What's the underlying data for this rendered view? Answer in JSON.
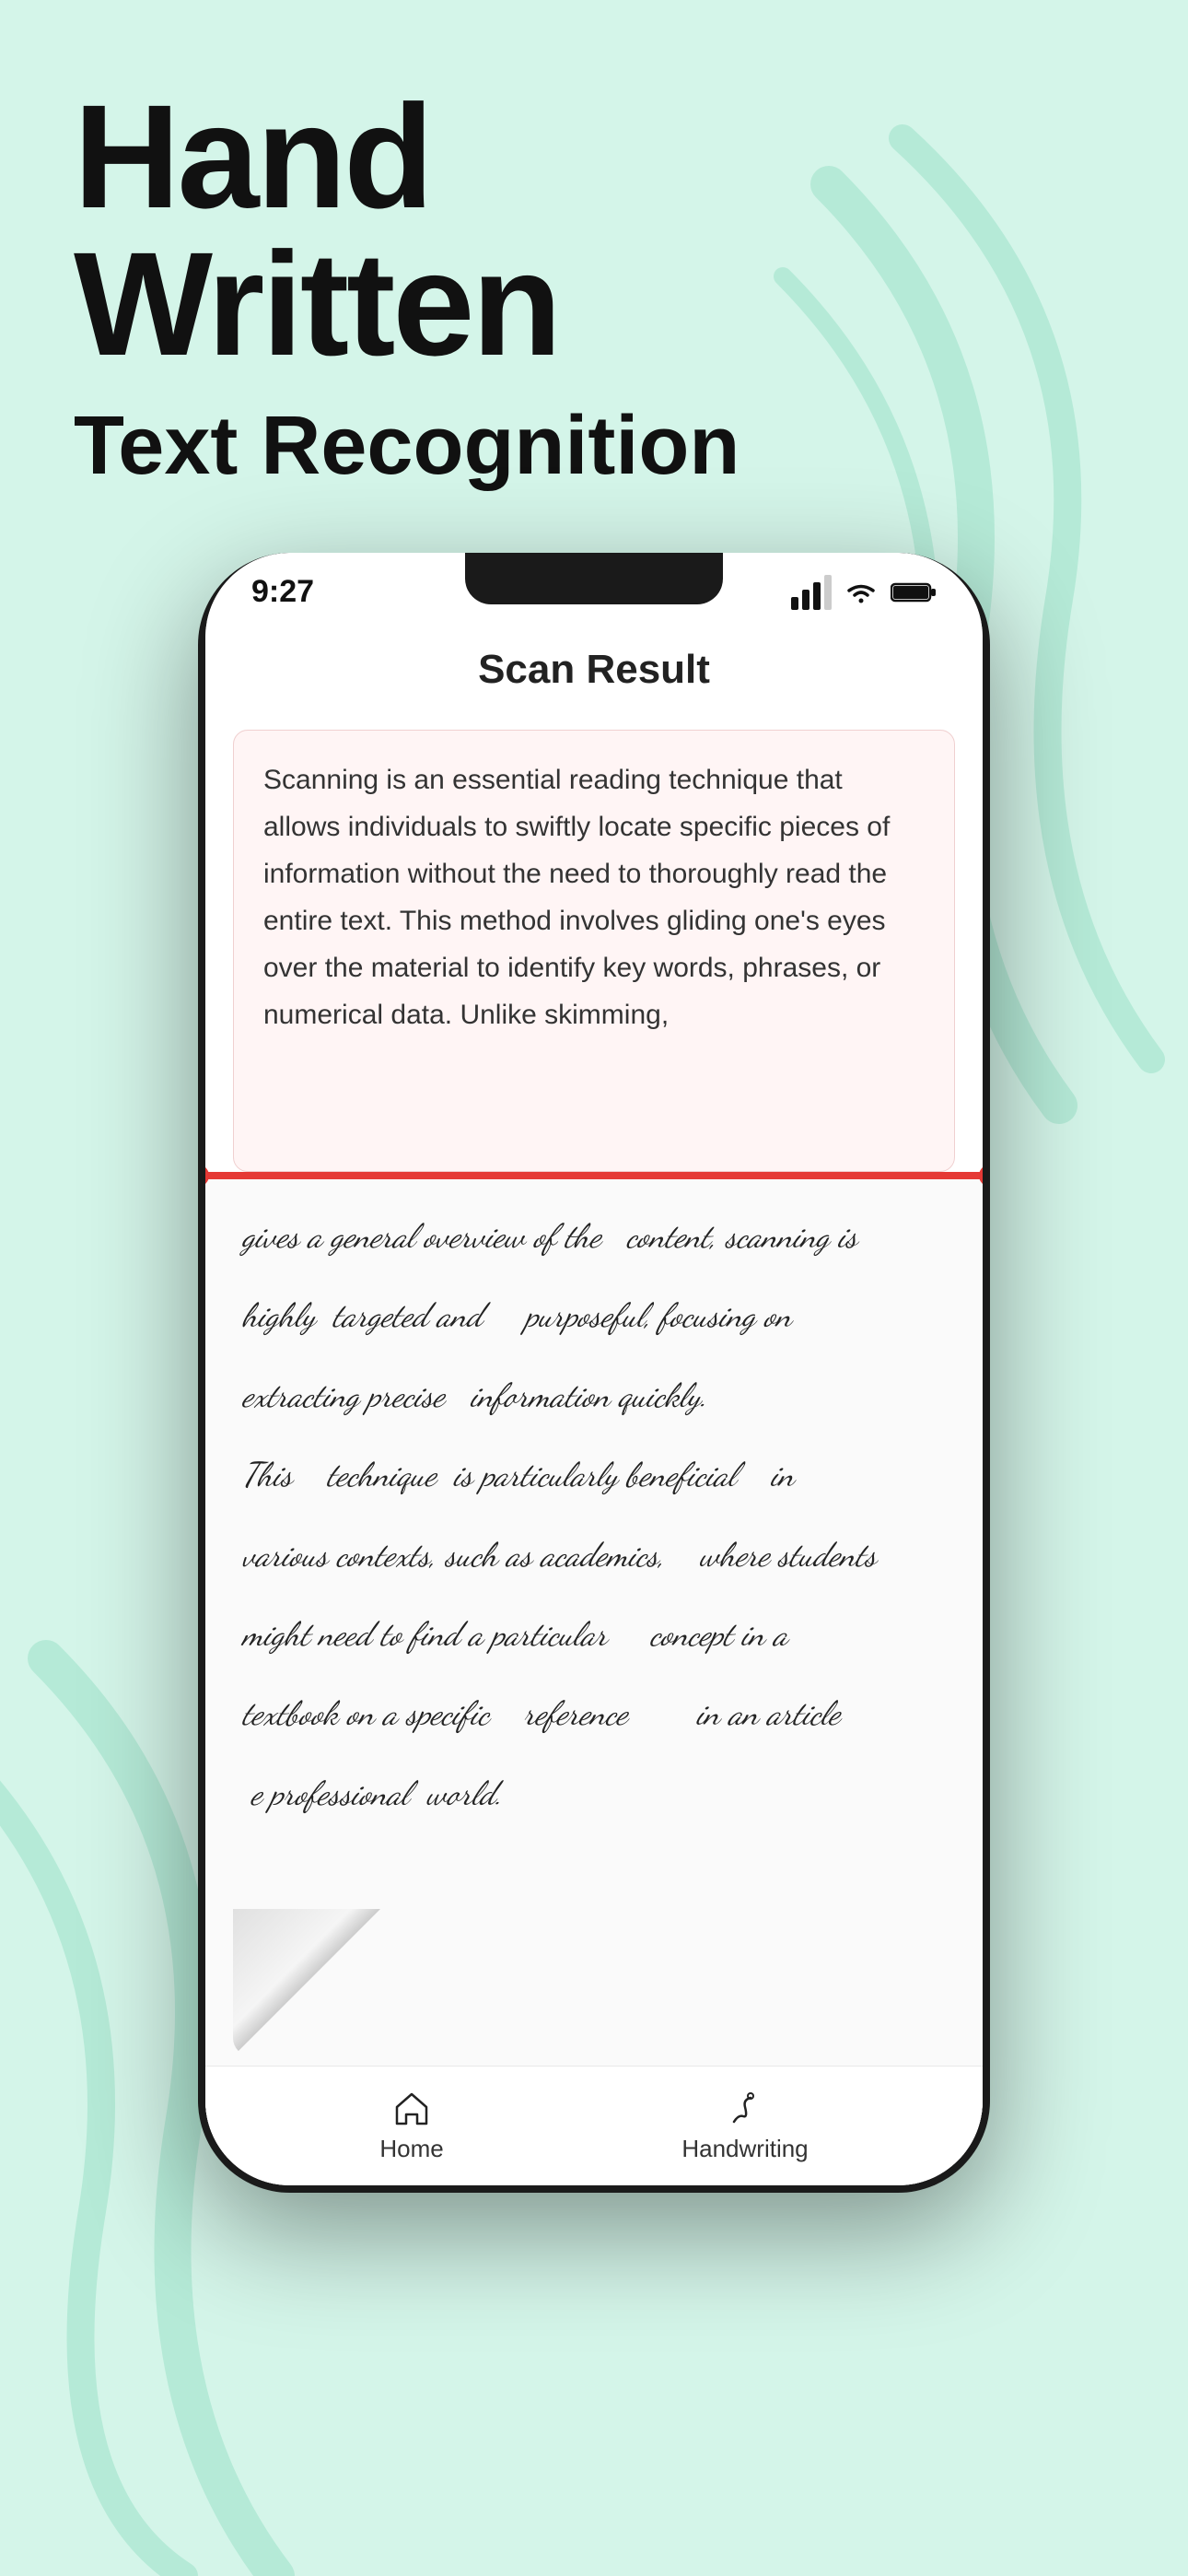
{
  "headline": {
    "line1": "Hand",
    "line2": "Written"
  },
  "subtitle": "Text Recognition",
  "phone": {
    "status_bar": {
      "time": "9:27"
    },
    "screen_title": "Scan Result",
    "typed_text": "Scanning is an essential reading technique that allows individuals to swiftly locate specific pieces of information without the need to thoroughly read the entire text. This method involves gliding one's eyes over the material to identify key words, phrases, or numerical data. Unlike skimming,",
    "handwritten_lines": [
      "gives a general overview of the   content, scanning is",
      "highly  targeted and     purposeful, focusing on",
      "extracting precise   information quickly.",
      "This    technique  is particularly beneficial   in",
      "various contexts, such as academics,   where students",
      "might need to find a particular    concept in a",
      "textbook on a specific   reference      in an article",
      "e professional  world."
    ],
    "bottom_nav": {
      "home_label": "Home",
      "handwriting_label": "Handwriting"
    }
  },
  "colors": {
    "background": "#d4f5e9",
    "scan_line": "#e53935",
    "typed_text_bg": "#fff5f5"
  }
}
